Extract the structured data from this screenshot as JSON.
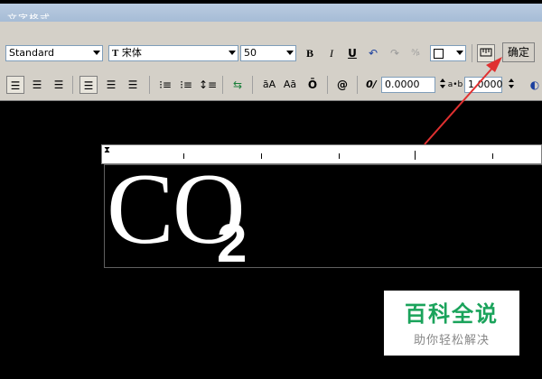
{
  "window": {
    "title": "文字格式"
  },
  "toolbar": {
    "style_name": "Standard",
    "font_name": "宋体",
    "font_icon": "T",
    "text_height": "50",
    "bold_label": "B",
    "italic_label": "I",
    "underline_label": "U",
    "ok_label": "确定",
    "oblique_value": "0.0000",
    "tracking_value": "1.0000",
    "oblique_prefix": "0/",
    "tracking_prefix": "a•b",
    "symbol_label": "@",
    "upper_label": "āA",
    "lower_label": "Aā",
    "overline_label": "Ō"
  },
  "editor": {
    "main_text": "CO",
    "subscript_text": "2"
  },
  "watermark": {
    "title": "百科全说",
    "subtitle": "助你轻松解决"
  },
  "colors": {
    "background": "#000000",
    "toolbar": "#d4d0c8",
    "arrow": "#e03030",
    "watermark_green": "#1aa35b"
  }
}
